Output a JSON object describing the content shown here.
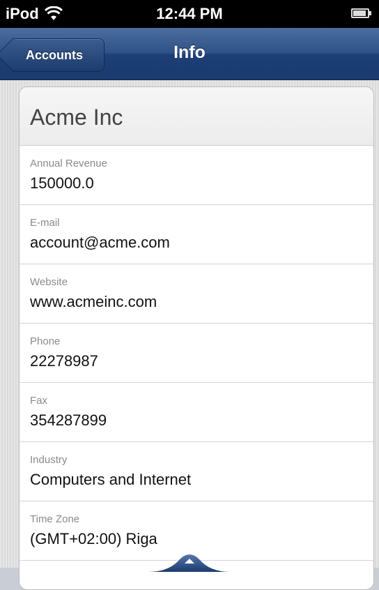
{
  "status_bar": {
    "carrier": "iPod",
    "time": "12:44 PM",
    "wifi_icon": "wifi-icon",
    "battery_icon": "battery-icon"
  },
  "nav_bar": {
    "title": "Info",
    "back_label": "Accounts",
    "bar_color": "#2f5288"
  },
  "account": {
    "name": "Acme Inc"
  },
  "fields": [
    {
      "label": "Annual Revenue",
      "value": "150000.0"
    },
    {
      "label": "E-mail",
      "value": "account@acme.com"
    },
    {
      "label": "Website",
      "value": "www.acmeinc.com"
    },
    {
      "label": "Phone",
      "value": "22278987"
    },
    {
      "label": "Fax",
      "value": "354287899"
    },
    {
      "label": "Industry",
      "value": "Computers and Internet"
    },
    {
      "label": "Time Zone",
      "value": "(GMT+02:00) Riga"
    }
  ],
  "bottom_tab": {
    "icon": "chevron-up-icon"
  }
}
